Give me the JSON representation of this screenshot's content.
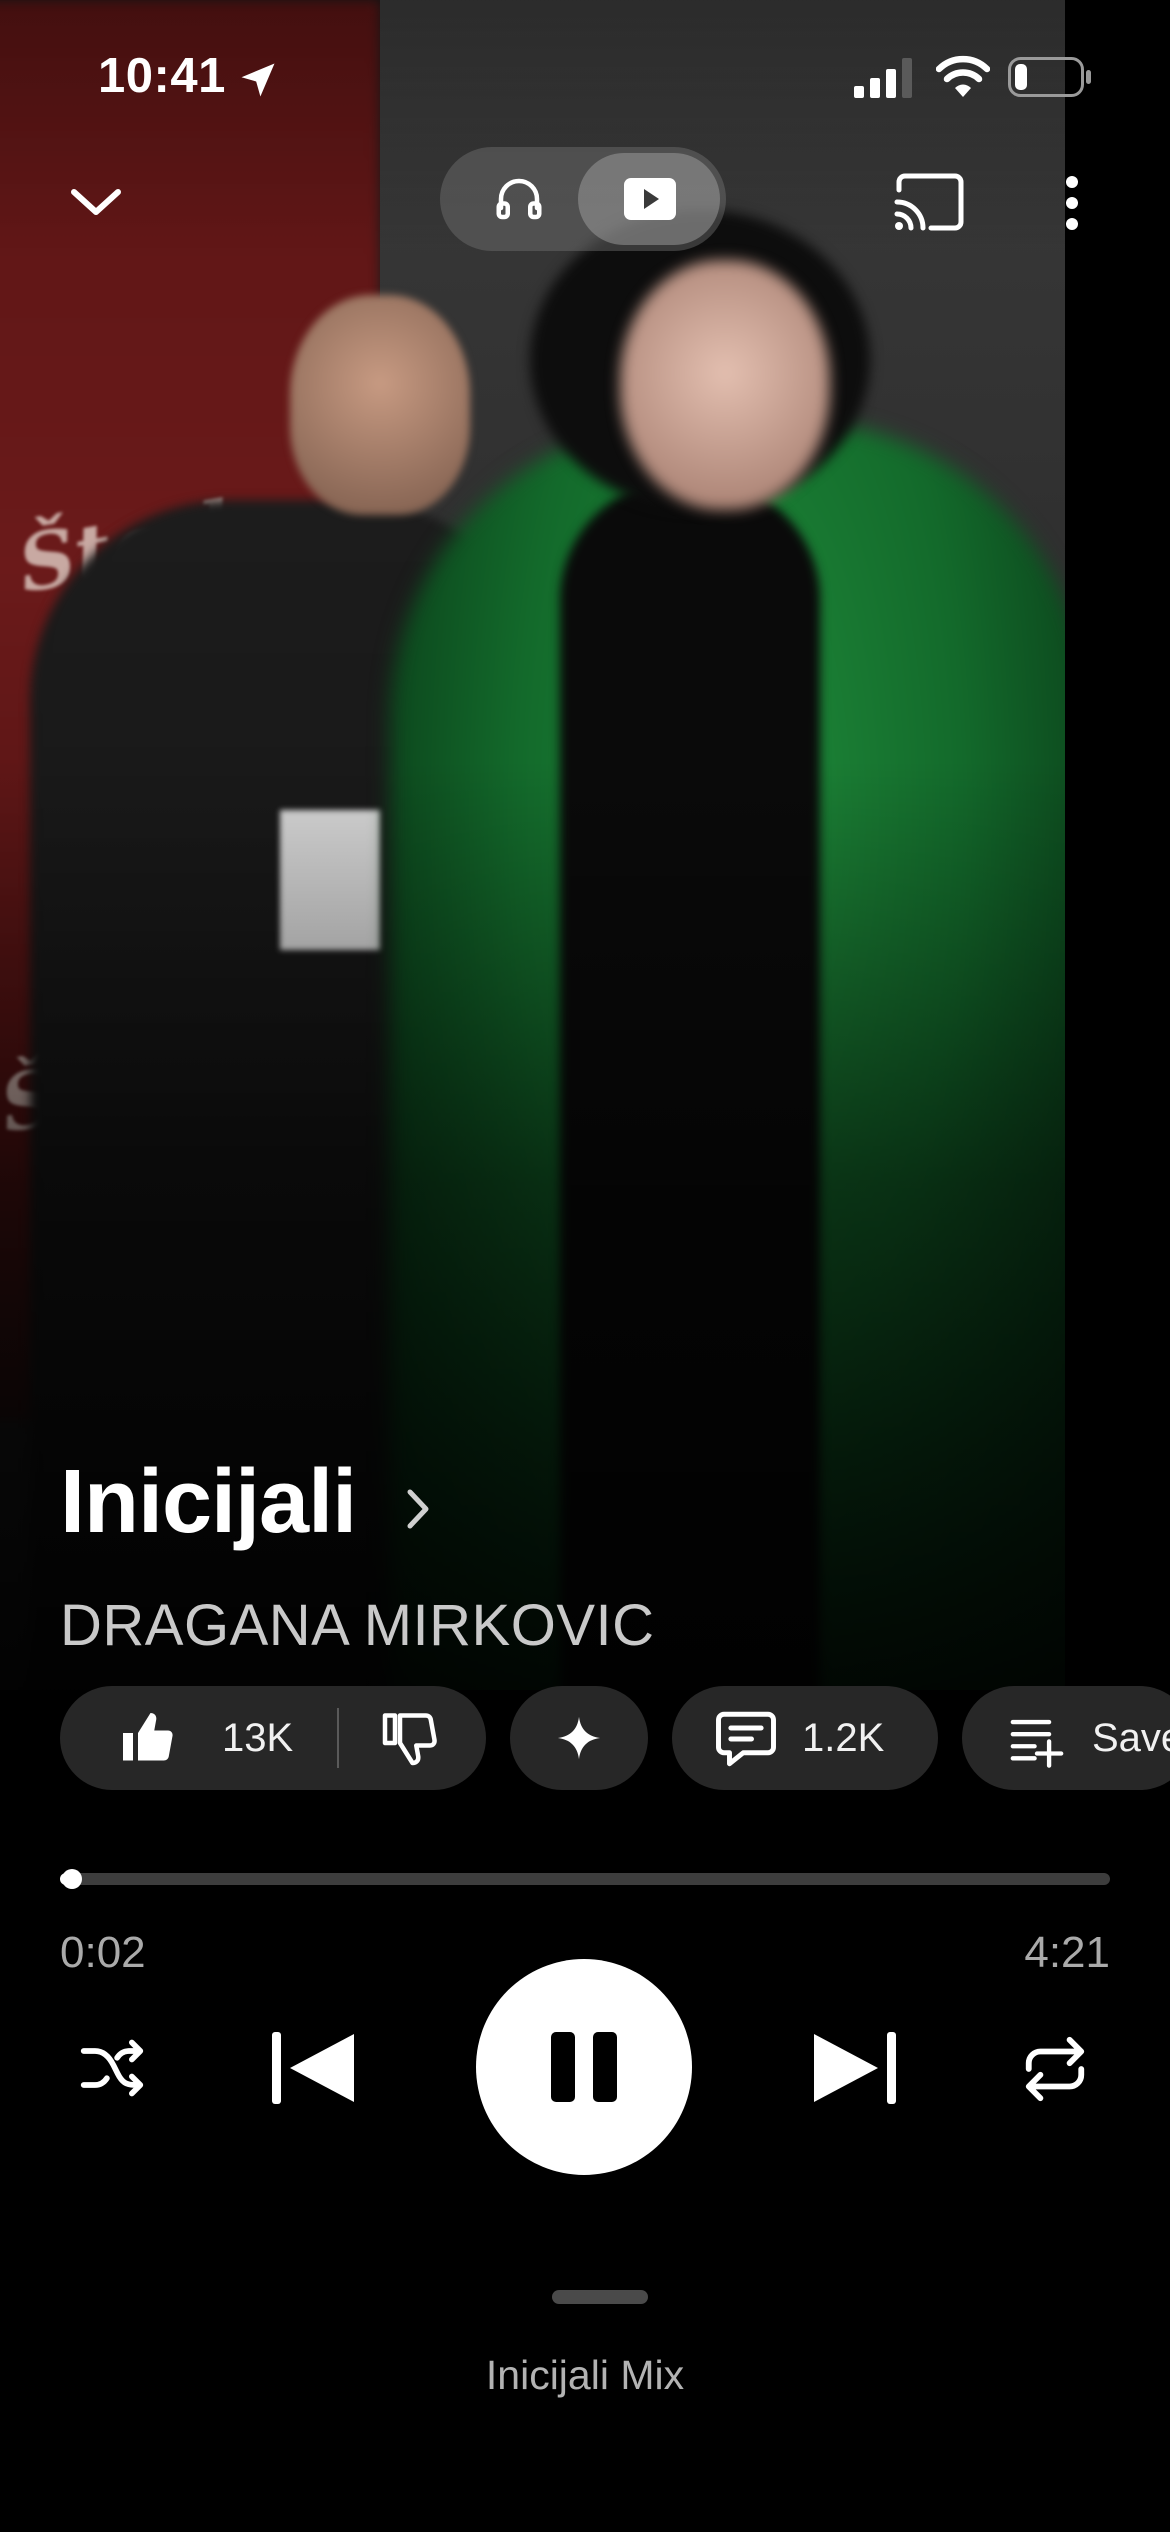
{
  "status_bar": {
    "time": "10:41",
    "location_icon": "location-arrow-icon",
    "signal_icon": "cell-signal-icon",
    "wifi_icon": "wifi-icon",
    "battery_icon": "battery-low-icon",
    "battery_level": 0.2
  },
  "top_bar": {
    "collapse_icon": "chevron-down-icon",
    "mode_toggle": {
      "options": [
        {
          "name": "song",
          "icon": "headphones-icon",
          "selected": false
        },
        {
          "name": "video",
          "icon": "play-rectangle-icon",
          "selected": true
        }
      ]
    },
    "cast_icon": "cast-icon",
    "more_icon": "more-vertical-icon"
  },
  "track": {
    "title": "Inicijali",
    "title_chevron_icon": "chevron-right-icon",
    "artist": "DRAGANA MIRKOVIC"
  },
  "actions": {
    "like_count": "13K",
    "like_icon": "thumbs-up-filled-icon",
    "dislike_icon": "thumbs-down-icon",
    "ask_icon": "sparkle-icon",
    "comment_count": "1.2K",
    "comment_icon": "comment-icon",
    "save_label": "Save",
    "save_icon": "playlist-add-icon"
  },
  "progress": {
    "elapsed": "0:02",
    "duration": "4:21",
    "fraction": 0.008
  },
  "controls": {
    "shuffle_icon": "shuffle-icon",
    "previous_icon": "skip-previous-icon",
    "pause_icon": "pause-icon",
    "next_icon": "skip-next-icon",
    "repeat_icon": "repeat-icon"
  },
  "up_next": {
    "label": "Inicijali Mix"
  },
  "colors": {
    "background": "#000000",
    "coat_green": "#1f8b3a",
    "chip_bg": "#272727",
    "secondary_text": "#aaaaaa"
  }
}
